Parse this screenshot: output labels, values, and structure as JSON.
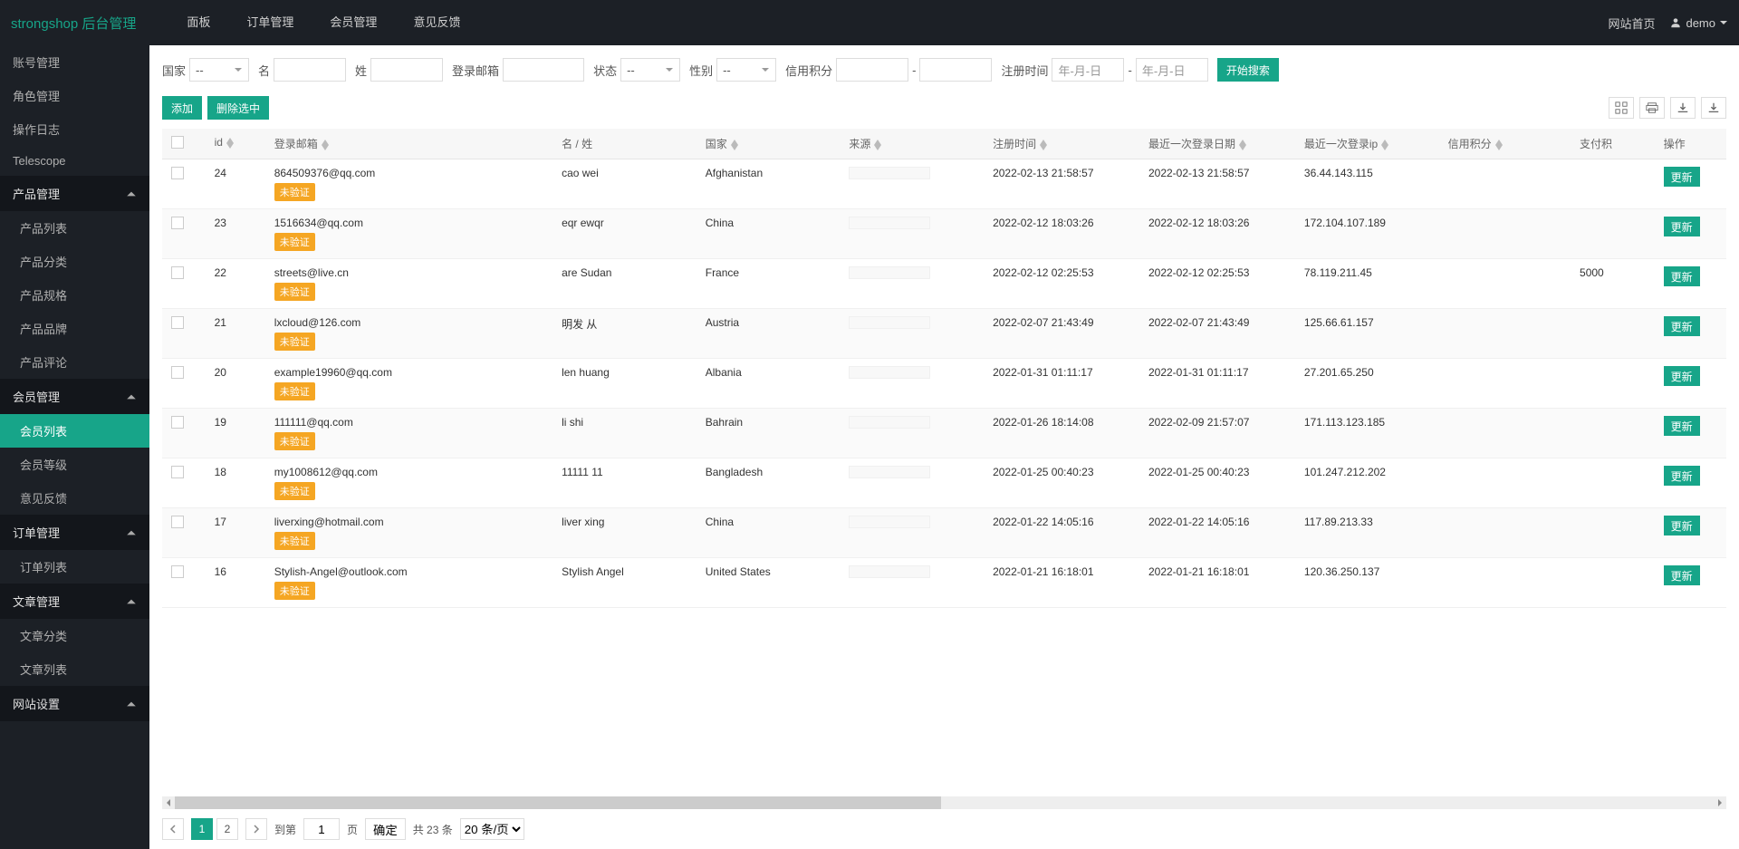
{
  "brand": "strongshop 后台管理",
  "topnav": [
    "面板",
    "订单管理",
    "会员管理",
    "意见反馈"
  ],
  "topbar": {
    "site_home": "网站首页",
    "user": "demo"
  },
  "sidebar": [
    {
      "type": "item",
      "label": "账号管理"
    },
    {
      "type": "item",
      "label": "角色管理"
    },
    {
      "type": "item",
      "label": "操作日志"
    },
    {
      "type": "item",
      "label": "Telescope"
    },
    {
      "type": "group",
      "label": "产品管理",
      "open": true,
      "items": [
        "产品列表",
        "产品分类",
        "产品规格",
        "产品品牌",
        "产品评论"
      ]
    },
    {
      "type": "group",
      "label": "会员管理",
      "open": true,
      "items": [
        "会员列表",
        "会员等级",
        "意见反馈"
      ],
      "active_index": 0
    },
    {
      "type": "group",
      "label": "订单管理",
      "open": true,
      "items": [
        "订单列表"
      ]
    },
    {
      "type": "group",
      "label": "文章管理",
      "open": true,
      "items": [
        "文章分类",
        "文章列表"
      ]
    },
    {
      "type": "group",
      "label": "网站设置",
      "open": true,
      "items": []
    }
  ],
  "filters": {
    "country_label": "国家",
    "country_value": "--",
    "name_label": "名",
    "surname_label": "姓",
    "email_label": "登录邮箱",
    "status_label": "状态",
    "status_value": "--",
    "gender_label": "性别",
    "gender_value": "--",
    "credits_label": "信用积分",
    "regtime_label": "注册时间",
    "date_placeholder": "年-月-日",
    "credits_dash": "-",
    "search_btn": "开始搜索"
  },
  "toolbar": {
    "add": "添加",
    "delete_selected": "删除选中"
  },
  "columns": {
    "id": "id",
    "email": "登录邮箱",
    "name": "名 / 姓",
    "country": "国家",
    "source": "来源",
    "regtime": "注册时间",
    "last_login_date": "最近一次登录日期",
    "last_login_ip": "最近一次登录ip",
    "credits": "信用积分",
    "pay_credits": "支付积",
    "ops": "操作"
  },
  "badge_unverified": "未验证",
  "update_btn": "更新",
  "rows": [
    {
      "id": "24",
      "email": "864509376@qq.com",
      "name": "cao wei",
      "country": "Afghanistan",
      "regtime": "2022-02-13 21:58:57",
      "last_login_date": "2022-02-13 21:58:57",
      "last_login_ip": "36.44.143.115",
      "credits": "",
      "pay_credits": ""
    },
    {
      "id": "23",
      "email": "1516634@qq.com",
      "name": "eqr ewqr",
      "country": "China",
      "regtime": "2022-02-12 18:03:26",
      "last_login_date": "2022-02-12 18:03:26",
      "last_login_ip": "172.104.107.189",
      "credits": "",
      "pay_credits": ""
    },
    {
      "id": "22",
      "email": "streets@live.cn",
      "name": "are Sudan",
      "country": "France",
      "regtime": "2022-02-12 02:25:53",
      "last_login_date": "2022-02-12 02:25:53",
      "last_login_ip": "78.119.211.45",
      "credits": "",
      "pay_credits": "5000"
    },
    {
      "id": "21",
      "email": "lxcloud@126.com",
      "name": "明发 从",
      "country": "Austria",
      "regtime": "2022-02-07 21:43:49",
      "last_login_date": "2022-02-07 21:43:49",
      "last_login_ip": "125.66.61.157",
      "credits": "",
      "pay_credits": ""
    },
    {
      "id": "20",
      "email": "example19960@qq.com",
      "name": "len huang",
      "country": "Albania",
      "regtime": "2022-01-31 01:11:17",
      "last_login_date": "2022-01-31 01:11:17",
      "last_login_ip": "27.201.65.250",
      "credits": "",
      "pay_credits": ""
    },
    {
      "id": "19",
      "email": "111111@qq.com",
      "name": "li shi",
      "country": "Bahrain",
      "regtime": "2022-01-26 18:14:08",
      "last_login_date": "2022-02-09 21:57:07",
      "last_login_ip": "171.113.123.185",
      "credits": "",
      "pay_credits": ""
    },
    {
      "id": "18",
      "email": "my1008612@qq.com",
      "name": "11111 11",
      "country": "Bangladesh",
      "regtime": "2022-01-25 00:40:23",
      "last_login_date": "2022-01-25 00:40:23",
      "last_login_ip": "101.247.212.202",
      "credits": "",
      "pay_credits": ""
    },
    {
      "id": "17",
      "email": "liverxing@hotmail.com",
      "name": "liver xing",
      "country": "China",
      "regtime": "2022-01-22 14:05:16",
      "last_login_date": "2022-01-22 14:05:16",
      "last_login_ip": "117.89.213.33",
      "credits": "",
      "pay_credits": ""
    },
    {
      "id": "16",
      "email": "Stylish-Angel@outlook.com",
      "name": "Stylish Angel",
      "country": "United States",
      "regtime": "2022-01-21 16:18:01",
      "last_login_date": "2022-01-21 16:18:01",
      "last_login_ip": "120.36.250.137",
      "credits": "",
      "pay_credits": ""
    }
  ],
  "pagination": {
    "pages": [
      "1",
      "2"
    ],
    "active_page": 0,
    "jump_label_prefix": "到第",
    "jump_value": "1",
    "jump_label_suffix": "页",
    "confirm": "确定",
    "total": "共 23 条",
    "page_size": "20 条/页"
  }
}
